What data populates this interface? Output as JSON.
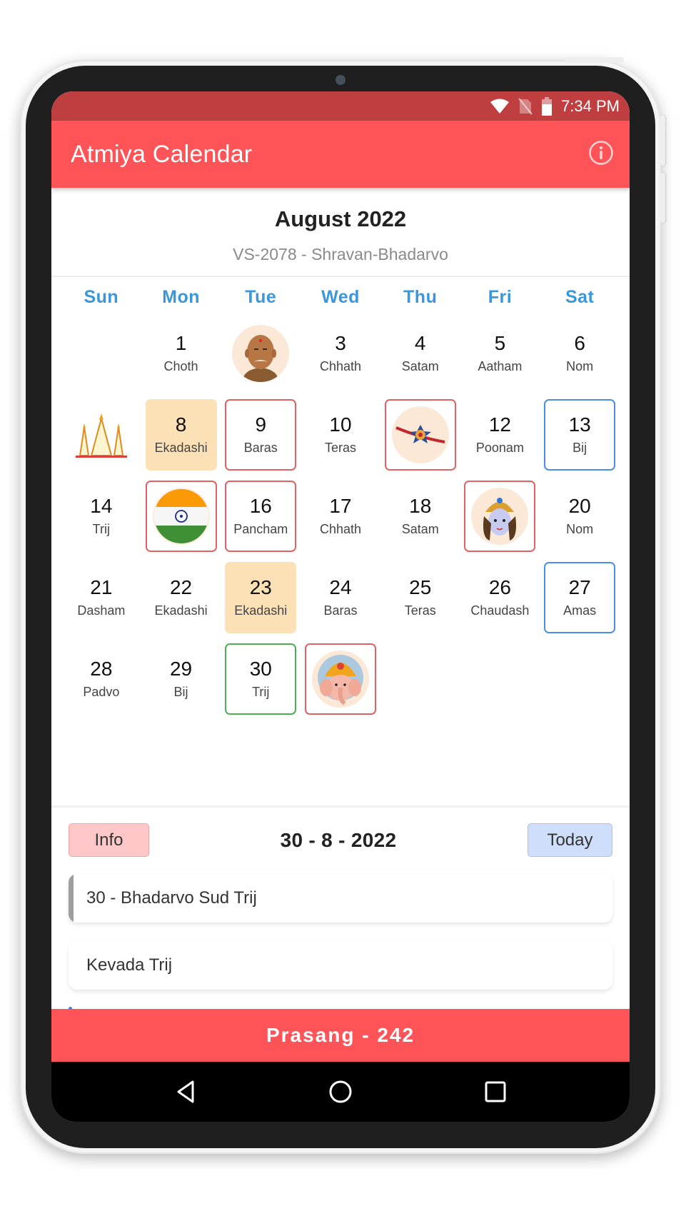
{
  "status_bar": {
    "time": "7:34 PM",
    "icons": [
      "wifi-icon",
      "no-sim-icon",
      "battery-icon"
    ]
  },
  "app_bar": {
    "title": "Atmiya Calendar",
    "action_icon": "info-icon"
  },
  "month_header": {
    "title": "August 2022",
    "subtitle": "VS-2078 - Shravan-Bhadarvo"
  },
  "weekdays": [
    "Sun",
    "Mon",
    "Tue",
    "Wed",
    "Thu",
    "Fri",
    "Sat"
  ],
  "days": [
    {
      "day": "",
      "tithi": "",
      "style": "empty"
    },
    {
      "day": "1",
      "tithi": "Choth",
      "style": "plain"
    },
    {
      "day": "2",
      "tithi": "",
      "style": "image",
      "image": "guru-portrait-icon"
    },
    {
      "day": "3",
      "tithi": "Chhath",
      "style": "plain"
    },
    {
      "day": "4",
      "tithi": "Satam",
      "style": "plain"
    },
    {
      "day": "5",
      "tithi": "Aatham",
      "style": "plain"
    },
    {
      "day": "6",
      "tithi": "Nom",
      "style": "plain"
    },
    {
      "day": "7",
      "tithi": "",
      "style": "image-plain",
      "image": "temple-shikhar-icon"
    },
    {
      "day": "8",
      "tithi": "Ekadashi",
      "style": "ekadashi"
    },
    {
      "day": "9",
      "tithi": "Baras",
      "style": "red"
    },
    {
      "day": "10",
      "tithi": "Teras",
      "style": "plain"
    },
    {
      "day": "11",
      "tithi": "",
      "style": "image-red",
      "image": "rakhi-icon"
    },
    {
      "day": "12",
      "tithi": "Poonam",
      "style": "plain"
    },
    {
      "day": "13",
      "tithi": "Bij",
      "style": "blue"
    },
    {
      "day": "14",
      "tithi": "Trij",
      "style": "plain"
    },
    {
      "day": "15",
      "tithi": "",
      "style": "image-red",
      "image": "india-flag-icon"
    },
    {
      "day": "16",
      "tithi": "Pancham",
      "style": "red"
    },
    {
      "day": "17",
      "tithi": "Chhath",
      "style": "plain"
    },
    {
      "day": "18",
      "tithi": "Satam",
      "style": "plain"
    },
    {
      "day": "19",
      "tithi": "",
      "style": "image-red",
      "image": "krishna-icon"
    },
    {
      "day": "20",
      "tithi": "Nom",
      "style": "plain"
    },
    {
      "day": "21",
      "tithi": "Dasham",
      "style": "plain"
    },
    {
      "day": "22",
      "tithi": "Ekadashi",
      "style": "plain"
    },
    {
      "day": "23",
      "tithi": "Ekadashi",
      "style": "ekadashi"
    },
    {
      "day": "24",
      "tithi": "Baras",
      "style": "plain"
    },
    {
      "day": "25",
      "tithi": "Teras",
      "style": "plain"
    },
    {
      "day": "26",
      "tithi": "Chaudash",
      "style": "plain"
    },
    {
      "day": "27",
      "tithi": "Amas",
      "style": "blue"
    },
    {
      "day": "28",
      "tithi": "Padvo",
      "style": "plain"
    },
    {
      "day": "29",
      "tithi": "Bij",
      "style": "plain"
    },
    {
      "day": "30",
      "tithi": "Trij",
      "style": "green"
    },
    {
      "day": "31",
      "tithi": "",
      "style": "image-red",
      "image": "ganesh-icon"
    }
  ],
  "detail": {
    "info_button": "Info",
    "selected_date": "30 - 8 - 2022",
    "today_button": "Today",
    "entries": [
      "30 - Bhadarvo Sud Trij",
      "Kevada Trij"
    ]
  },
  "footer": {
    "prasang_label": "Prasang - 242"
  },
  "nav_bar": {
    "buttons": [
      "back-icon",
      "home-icon",
      "recents-icon"
    ]
  },
  "colors": {
    "primary": "#fe5357",
    "status_bar": "#bf3f41",
    "weekday": "#3a97db",
    "ekadashi_bg": "#fde1b6",
    "festival_border": "#e26163",
    "bij_amas_border": "#4a8fde",
    "selected_border": "#4caf50"
  }
}
